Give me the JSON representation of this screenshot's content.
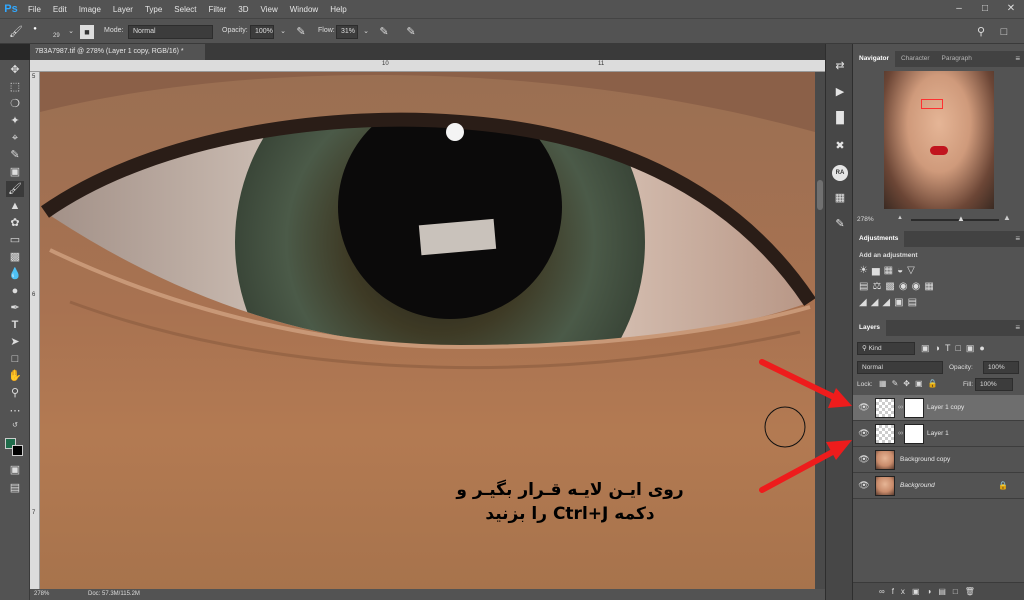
{
  "menubar": {
    "logo": "Ps",
    "items": [
      "File",
      "Edit",
      "Image",
      "Layer",
      "Type",
      "Select",
      "Filter",
      "3D",
      "View",
      "Window",
      "Help"
    ]
  },
  "options": {
    "brush_size": "29",
    "mode_label": "Mode:",
    "mode_value": "Normal",
    "opacity_label": "Opacity:",
    "opacity_value": "100%",
    "flow_label": "Flow:",
    "flow_value": "31%"
  },
  "document": {
    "tab_title": "7B3A7987.tif @ 278% (Layer 1 copy, RGB/16) *",
    "ruler_top": [
      "10",
      "11"
    ],
    "ruler_left": [
      "5",
      "6",
      "7"
    ]
  },
  "statusbar": {
    "zoom": "278%",
    "doc": "Doc: 57.3M/115.2M"
  },
  "navigator": {
    "tabs": [
      "Navigator",
      "Character",
      "Paragraph"
    ],
    "zoom": "278%"
  },
  "adjustments": {
    "title": "Adjustments",
    "subtitle": "Add an adjustment"
  },
  "layers": {
    "title": "Layers",
    "kind_label": "Kind",
    "blend_mode": "Normal",
    "opacity_label": "Opacity:",
    "opacity_value": "100%",
    "lock_label": "Lock:",
    "fill_label": "Fill:",
    "fill_value": "100%",
    "items": [
      {
        "name": "Layer 1 copy"
      },
      {
        "name": "Layer 1"
      },
      {
        "name": "Background copy"
      },
      {
        "name": "Background"
      }
    ]
  },
  "annotation": {
    "line1": "روی ایـن لایـه قـرار بگیـر و",
    "line2": "دکمه Ctrl+J را بزنید"
  },
  "colors": {
    "foreground": "#1f6b4a",
    "background": "#000000",
    "arrow": "#ee1c1c",
    "ps_blue": "#31a8ff"
  }
}
